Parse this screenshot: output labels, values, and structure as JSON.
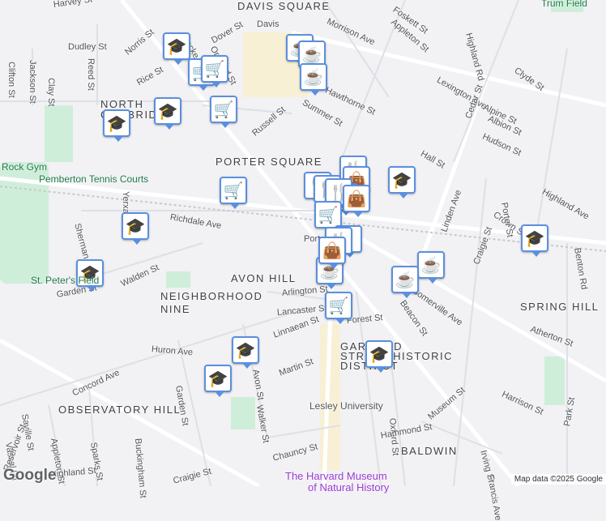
{
  "neighborhoods": [
    "DAVIS SQUARE",
    "NORTH",
    "CAMBRIDGE",
    "PORTER SQUARE",
    "AVON HILL",
    "NEIGHBORHOOD",
    "NINE",
    "SPRING HILL",
    "GARFIELD",
    "STREET HISTORIC",
    "DISTRICT",
    "OBSERVATORY HILL",
    "BALDWIN"
  ],
  "streets": [
    "Harvey St",
    "Dudley St",
    "Norris St",
    "Rice St",
    "Locke St",
    "Orchard St",
    "Dover St",
    "Davis",
    "Morrison Ave",
    "Foskett St",
    "Appleton St",
    "Highland Rd",
    "Clyde St",
    "Lexington Ave",
    "Alpine St",
    "Albion St",
    "Hudson St",
    "Hawthorne St",
    "Summer St",
    "Cedar St",
    "Hall St",
    "Russell St",
    "Clifton St",
    "Jackson St",
    "Clay St",
    "Reed St",
    "Yerxa Rd",
    "Richdale Ave",
    "Sherman St",
    "Walden St",
    "Garden St",
    "Highland Ave",
    "Crown St",
    "Linden Ave",
    "Porter St",
    "Benton Rd",
    "Craigie St",
    "Arlington St",
    "Lancaster St",
    "Forest St",
    "Linnaean St",
    "Beacon St",
    "Somerville Ave",
    "Atherton St",
    "Huron Ave",
    "Concord Ave",
    "Saville St",
    "Vassal Ln",
    "Avon St",
    "Martin St",
    "Walker St",
    "Garden St",
    "Harrison St",
    "Oxford St",
    "Museum St",
    "Hammond St",
    "Park St",
    "Appleton St",
    "Sparks St",
    "Buckingham St",
    "Reservoir St",
    "Highland St",
    "Chauncy St",
    "Irving St",
    "Craigie St",
    "Francis Ave",
    "Porter"
  ],
  "pois": {
    "rock_gym": "Rock Gym",
    "pemberton": "Pemberton Tennis Courts",
    "st_peter": "St. Peter's Field",
    "lesley": "Lesley University",
    "harvard_museum": "The Harvard Museum",
    "harvard_museum2": "of Natural History",
    "trum": "Trum Field"
  },
  "footer": {
    "logo": "Google",
    "attribution": "Map data ©2025 Google"
  }
}
